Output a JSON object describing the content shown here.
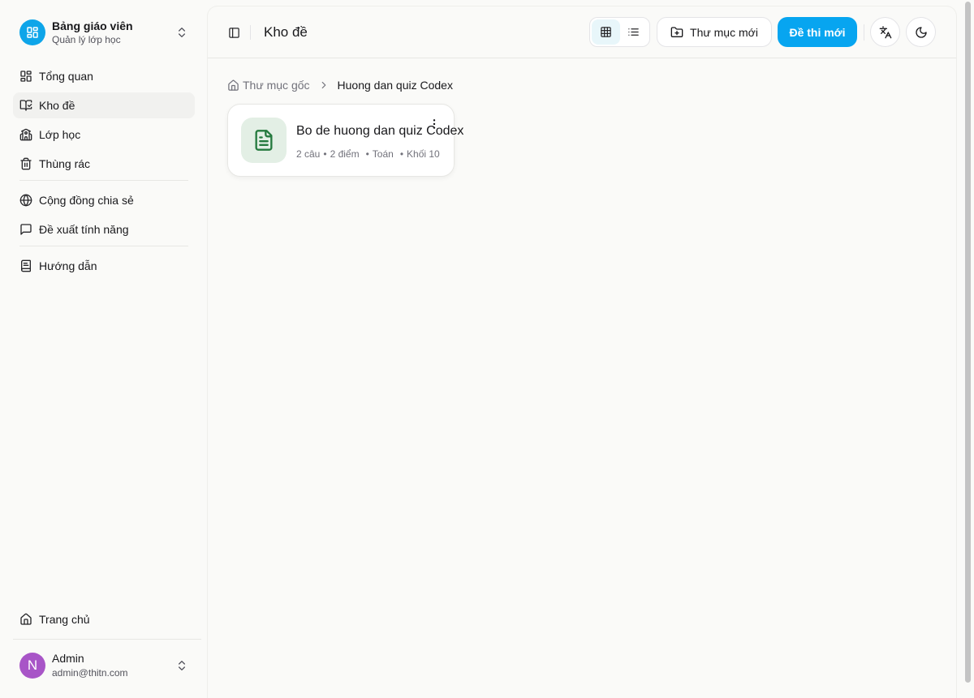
{
  "team": {
    "title": "Bảng giáo viên",
    "subtitle": "Quản lý lớp học"
  },
  "nav": {
    "overview": "Tổng quan",
    "library": "Kho đề",
    "classes": "Lớp học",
    "trash": "Thùng rác",
    "community": "Cộng đồng chia sẻ",
    "feedback": "Đề xuất tính năng",
    "guide": "Hướng dẫn",
    "home": "Trang chủ"
  },
  "user": {
    "initial": "N",
    "name": "Admin",
    "email": "admin@thitn.com"
  },
  "header": {
    "title": "Kho đề",
    "new_folder": "Thư mục mới",
    "new_exam": "Đề thi mới"
  },
  "breadcrumb": {
    "root": "Thư mục gốc",
    "current": "Huong dan quiz Codex"
  },
  "quiz": {
    "title": "Bo de huong dan quiz Codex",
    "questions": "2 câu",
    "points": "2 điểm",
    "subject": "Toán",
    "grade": "Khối 10",
    "bullet": "•"
  },
  "colors": {
    "primary": "#07a5f0",
    "avatar": "#a855c7",
    "quiz_icon_bg": "#e3efe5",
    "quiz_icon": "#257a3e"
  }
}
